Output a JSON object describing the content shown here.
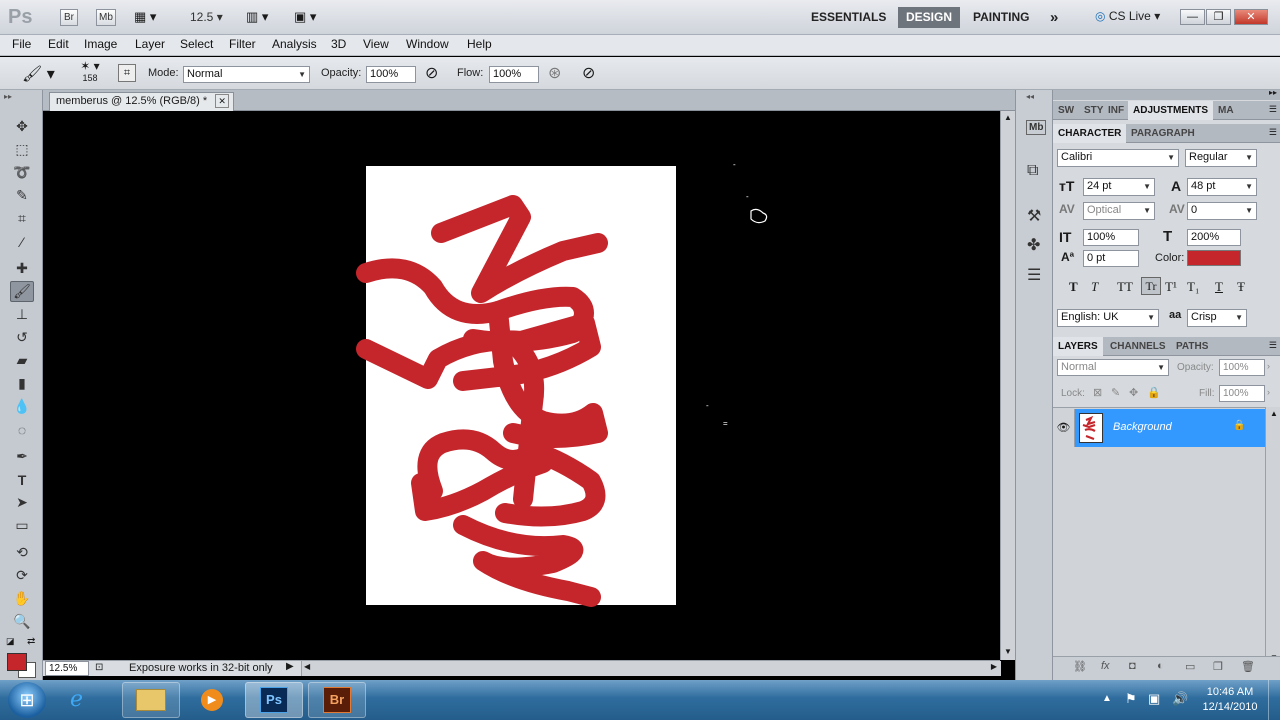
{
  "app": {
    "logo": "Ps",
    "bridge": "Br",
    "mini_bridge": "Mb",
    "zoom": "12.5"
  },
  "workspaces": {
    "essentials": "ESSENTIALS",
    "design": "DESIGN",
    "painting": "PAINTING",
    "more": "»",
    "cslive": "CS Live"
  },
  "menu": [
    "File",
    "Edit",
    "Image",
    "Layer",
    "Select",
    "Filter",
    "Analysis",
    "3D",
    "View",
    "Window",
    "Help"
  ],
  "options": {
    "brush_size": "158",
    "mode_label": "Mode:",
    "mode_value": "Normal",
    "opacity_label": "Opacity:",
    "opacity_value": "100%",
    "flow_label": "Flow:",
    "flow_value": "100%"
  },
  "document": {
    "tab_title": "memberus @ 12.5% (RGB/8) *",
    "close": "✕"
  },
  "status": {
    "zoom": "12.5%",
    "message": "Exposure works in 32-bit only"
  },
  "top_panel_tabs": [
    "SW",
    "STY",
    "INF",
    "ADJUSTMENTS",
    "MA"
  ],
  "character": {
    "tabs": [
      "CHARACTER",
      "PARAGRAPH"
    ],
    "font_family": "Calibri",
    "font_style": "Regular",
    "size": "24 pt",
    "leading": "48 pt",
    "kerning": "Optical",
    "tracking": "0",
    "vscale": "100%",
    "hscale": "200%",
    "baseline": "0 pt",
    "color_label": "Color:",
    "color": "#c4262c",
    "language": "English: UK",
    "antialias_label": "aa",
    "antialias": "Crisp",
    "type_buttons": [
      "T",
      "T",
      "TT",
      "Tr",
      "T¹",
      "T₁",
      "T",
      "Ŧ"
    ]
  },
  "layers": {
    "tabs": [
      "LAYERS",
      "CHANNELS",
      "PATHS"
    ],
    "blend": "Normal",
    "opacity_label": "Opacity:",
    "opacity": "100%",
    "lock_label": "Lock:",
    "fill_label": "Fill:",
    "fill": "100%",
    "items": [
      {
        "name": "Background"
      }
    ]
  },
  "taskbar": {
    "time": "10:46 AM",
    "date": "12/14/2010",
    "ps": "Ps",
    "br": "Br"
  },
  "colors": {
    "brush": "#c4262c",
    "accent": "#3399ff"
  }
}
